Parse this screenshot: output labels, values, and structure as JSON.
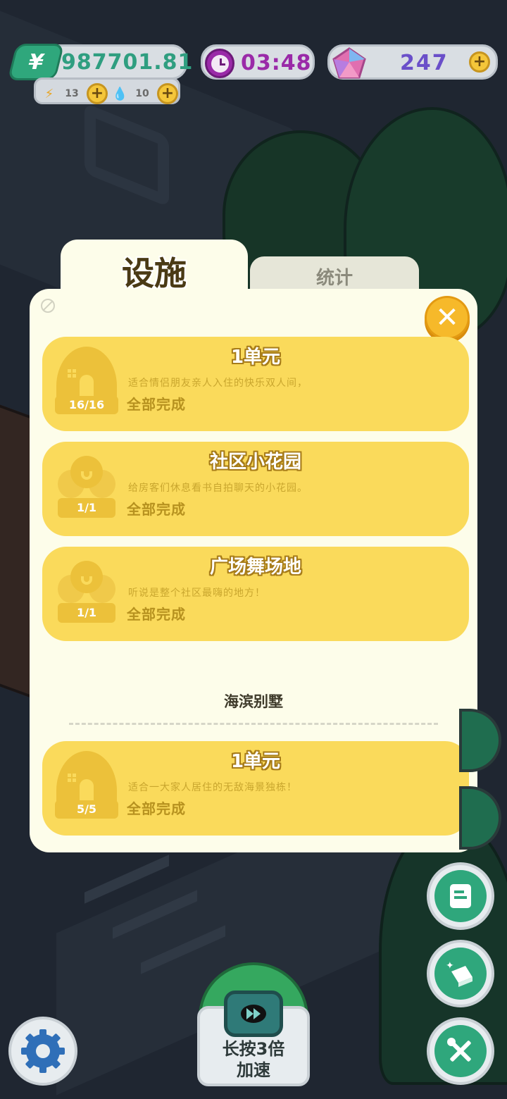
{
  "hud": {
    "money": "987701.81",
    "money_symbol": "¥",
    "energy": "13",
    "water": "10",
    "timer": "03:48",
    "gems": "247"
  },
  "tabs": [
    {
      "label": "设施",
      "active": true
    },
    {
      "label": "统计",
      "active": false
    }
  ],
  "sections": [
    {
      "title": "",
      "items": [
        {
          "name": "1单元",
          "desc": "适合情侣朋友亲人入住的快乐双人间，",
          "status": "全部完成",
          "count": "16/16",
          "icon": "house-icon"
        },
        {
          "name": "社区小花园",
          "desc": "给房客们休息看书自拍聊天的小花园。",
          "status": "全部完成",
          "count": "1/1",
          "icon": "garden-icon"
        },
        {
          "name": "广场舞场地",
          "desc": "听说是整个社区最嗨的地方！",
          "status": "全部完成",
          "count": "1/1",
          "icon": "garden-icon"
        }
      ]
    },
    {
      "title": "海滨别墅",
      "items": [
        {
          "name": "1单元",
          "desc": "适合一大家人居住的无敌海景独栋！",
          "status": "全部完成",
          "count": "5/5",
          "icon": "house-icon"
        }
      ]
    }
  ],
  "speed_button": {
    "line1": "长按3倍",
    "line2": "加速"
  },
  "colors": {
    "card": "#fada5b",
    "panel": "#fdfdea",
    "money": "#2f9e80",
    "timer": "#9a2aa8",
    "gems": "#6a4fc9",
    "close": "#f6b92a"
  }
}
